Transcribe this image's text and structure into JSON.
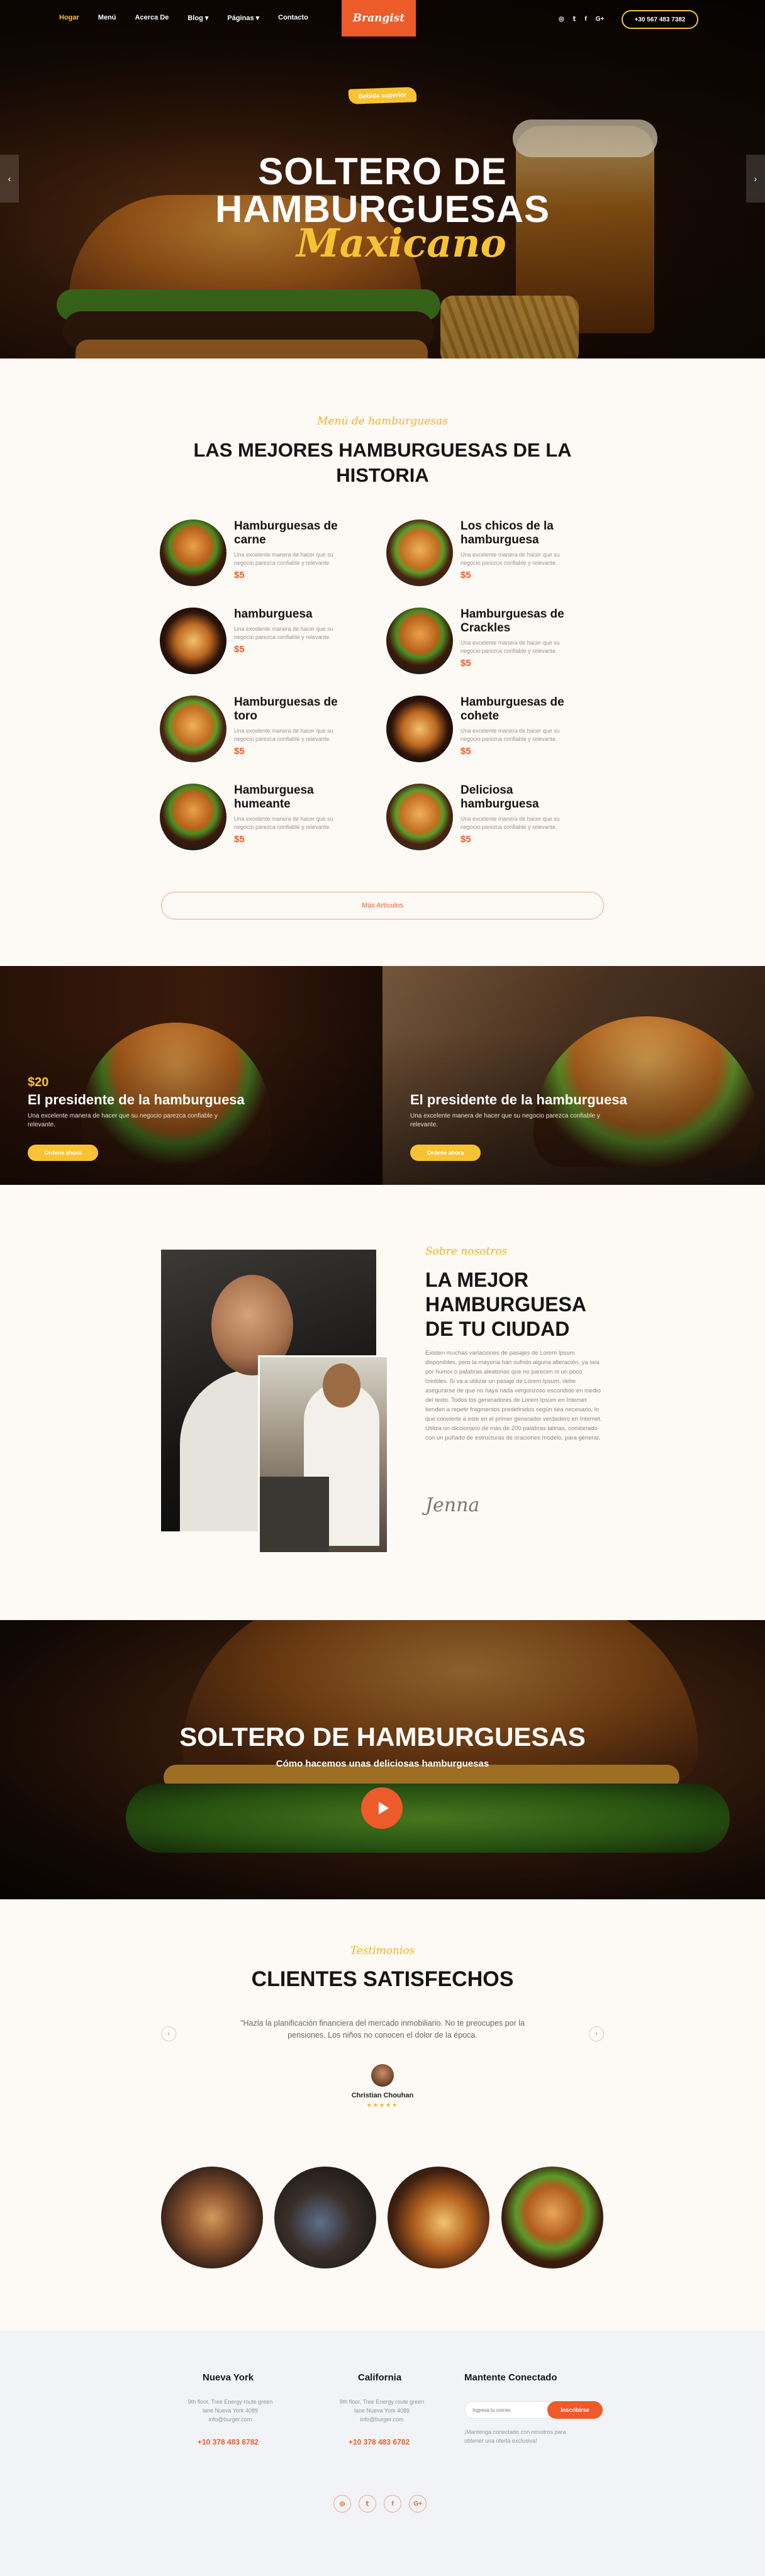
{
  "nav": {
    "items": [
      {
        "label": "Hogar"
      },
      {
        "label": "Menú"
      },
      {
        "label": "Acerca De"
      },
      {
        "label": "Blog ▾"
      },
      {
        "label": "Páginas ▾"
      },
      {
        "label": "Contacto"
      }
    ],
    "active": "Hogar",
    "logo_text": "Brangist",
    "social_icons": [
      "instagram-icon",
      "twitter-icon",
      "facebook-icon",
      "google-plus-icon"
    ],
    "social_glyphs": [
      "◎",
      "𝕥",
      "f",
      "G+"
    ],
    "phone": "+30 567 483 7382"
  },
  "hero": {
    "tag": "Bebida superior",
    "title_line1": "SOLTERO DE",
    "title_line2": "HAMBURGUESAS",
    "script": "Maxicano",
    "arrow_left": "‹",
    "arrow_right": "›"
  },
  "menu_section": {
    "subtitle": "Menú de hamburguesas",
    "title_line1": "LAS MEJORES HAMBURGUESAS DE LA",
    "title_line2": "HISTORIA",
    "items": [
      {
        "name": "Hamburguesas de carne",
        "desc": "Una excelente manera de hacer que su negocio parezca confiable y relevante.",
        "price": "$5"
      },
      {
        "name": "Los chicos de la hamburguesa",
        "desc": "Una excelente manera de hacer que su negocio parezca confiable y relevante.",
        "price": "$5"
      },
      {
        "name": "hamburguesa",
        "desc": "Una excelente manera de hacer que su negocio parezca confiable y relevante.",
        "price": "$5"
      },
      {
        "name": "Hamburguesas de Crackles",
        "desc": "Una excelente manera de hacer que su negocio parezca confiable y relevante.",
        "price": "$5"
      },
      {
        "name": "Hamburguesas de toro",
        "desc": "Una excelente manera de hacer que su negocio parezca confiable y relevante.",
        "price": "$5"
      },
      {
        "name": "Hamburguesas de cohete",
        "desc": "Una excelente manera de hacer que su negocio parezca confiable y relevante.",
        "price": "$5"
      },
      {
        "name": "Hamburguesa humeante",
        "desc": "Una excelente manera de hacer que su negocio parezca confiable y relevante.",
        "price": "$5"
      },
      {
        "name": "Deliciosa hamburguesa",
        "desc": "Una excelente manera de hacer que su negocio parezca confiable y relevante.",
        "price": "$5"
      }
    ],
    "more_button": "Más Artículos"
  },
  "promos": [
    {
      "price": "$20",
      "title": "El presidente de la hamburguesa",
      "desc": "Una excelente manera de hacer que su negocio parezca confiable y relevante.",
      "button": "Ordene ahora"
    },
    {
      "price": "",
      "title": "El presidente de la hamburguesa",
      "desc": "Una excelente manera de hacer que su negocio parezca confiable y relevante.",
      "button": "Ordene ahora"
    }
  ],
  "about": {
    "subtitle": "Sobre nosotros",
    "title": "LA MEJOR HAMBURGUESA DE TU CIUDAD",
    "text": "Existen muchas variaciones de pasajes de Lorem Ipsum disponibles, pero la mayoría han sufrido alguna alteración, ya sea por humor o palabras aleatorias que no parecen ni un poco creíbles. Si va a utilizar un pasaje de Lorem Ipsum, debe asegurarse de que no haya nada vergonzoso escondido en medio del texto. Todos los generadores de Lorem Ipsum en Internet tienden a repetir fragmentos predefinidos según sea necesario, lo que convierte a este en el primer generador verdadero en Internet. Utiliza un diccionario de más de 200 palabras latinas, combinado con un puñado de estructuras de oraciones modelo, para generar.",
    "signature": "Jenna"
  },
  "video": {
    "title": "SOLTERO DE HAMBURGUESAS",
    "subtitle": "Cómo hacemos unas deliciosas hamburguesas"
  },
  "testimonials": {
    "subtitle": "Testimonios",
    "title": "CLIENTES SATISFECHOS",
    "quote": "\"Hazla la planificación financiera del mercado inmobiliario. No te preocupes por la pensiones. Los niños no conocen el dolor de la época.",
    "name": "Christian Chouhan",
    "stars": "★★★★★",
    "arrow_left": "‹",
    "arrow_right": "›"
  },
  "footer": {
    "col1": {
      "heading": "Nueva York",
      "address": "9th floor, Tree Energy route green lane Nueva York 4089 info@burger.com",
      "phone": "+10 378 483 6782"
    },
    "col2": {
      "heading": "California",
      "address": "9th floor, Tree Energy route green lane Nueva York 4089 info@burger.com",
      "phone": "+10 378 483 6782"
    },
    "col3": {
      "heading": "Mantente Conectado",
      "input_placeholder": "Ingresa tu correo",
      "button": "Inscribirse",
      "text": "¡Mantenga conectado con nosotros para obtener una oferta exclusiva!"
    },
    "social_icons": [
      "instagram-icon",
      "twitter-icon",
      "facebook-icon",
      "google-plus-icon"
    ],
    "social_glyphs": [
      "◎",
      "𝕥",
      "f",
      "G+"
    ]
  },
  "colors": {
    "accent": "#ee5b2a",
    "highlight": "#f7c334",
    "script": "#f2b41f"
  }
}
